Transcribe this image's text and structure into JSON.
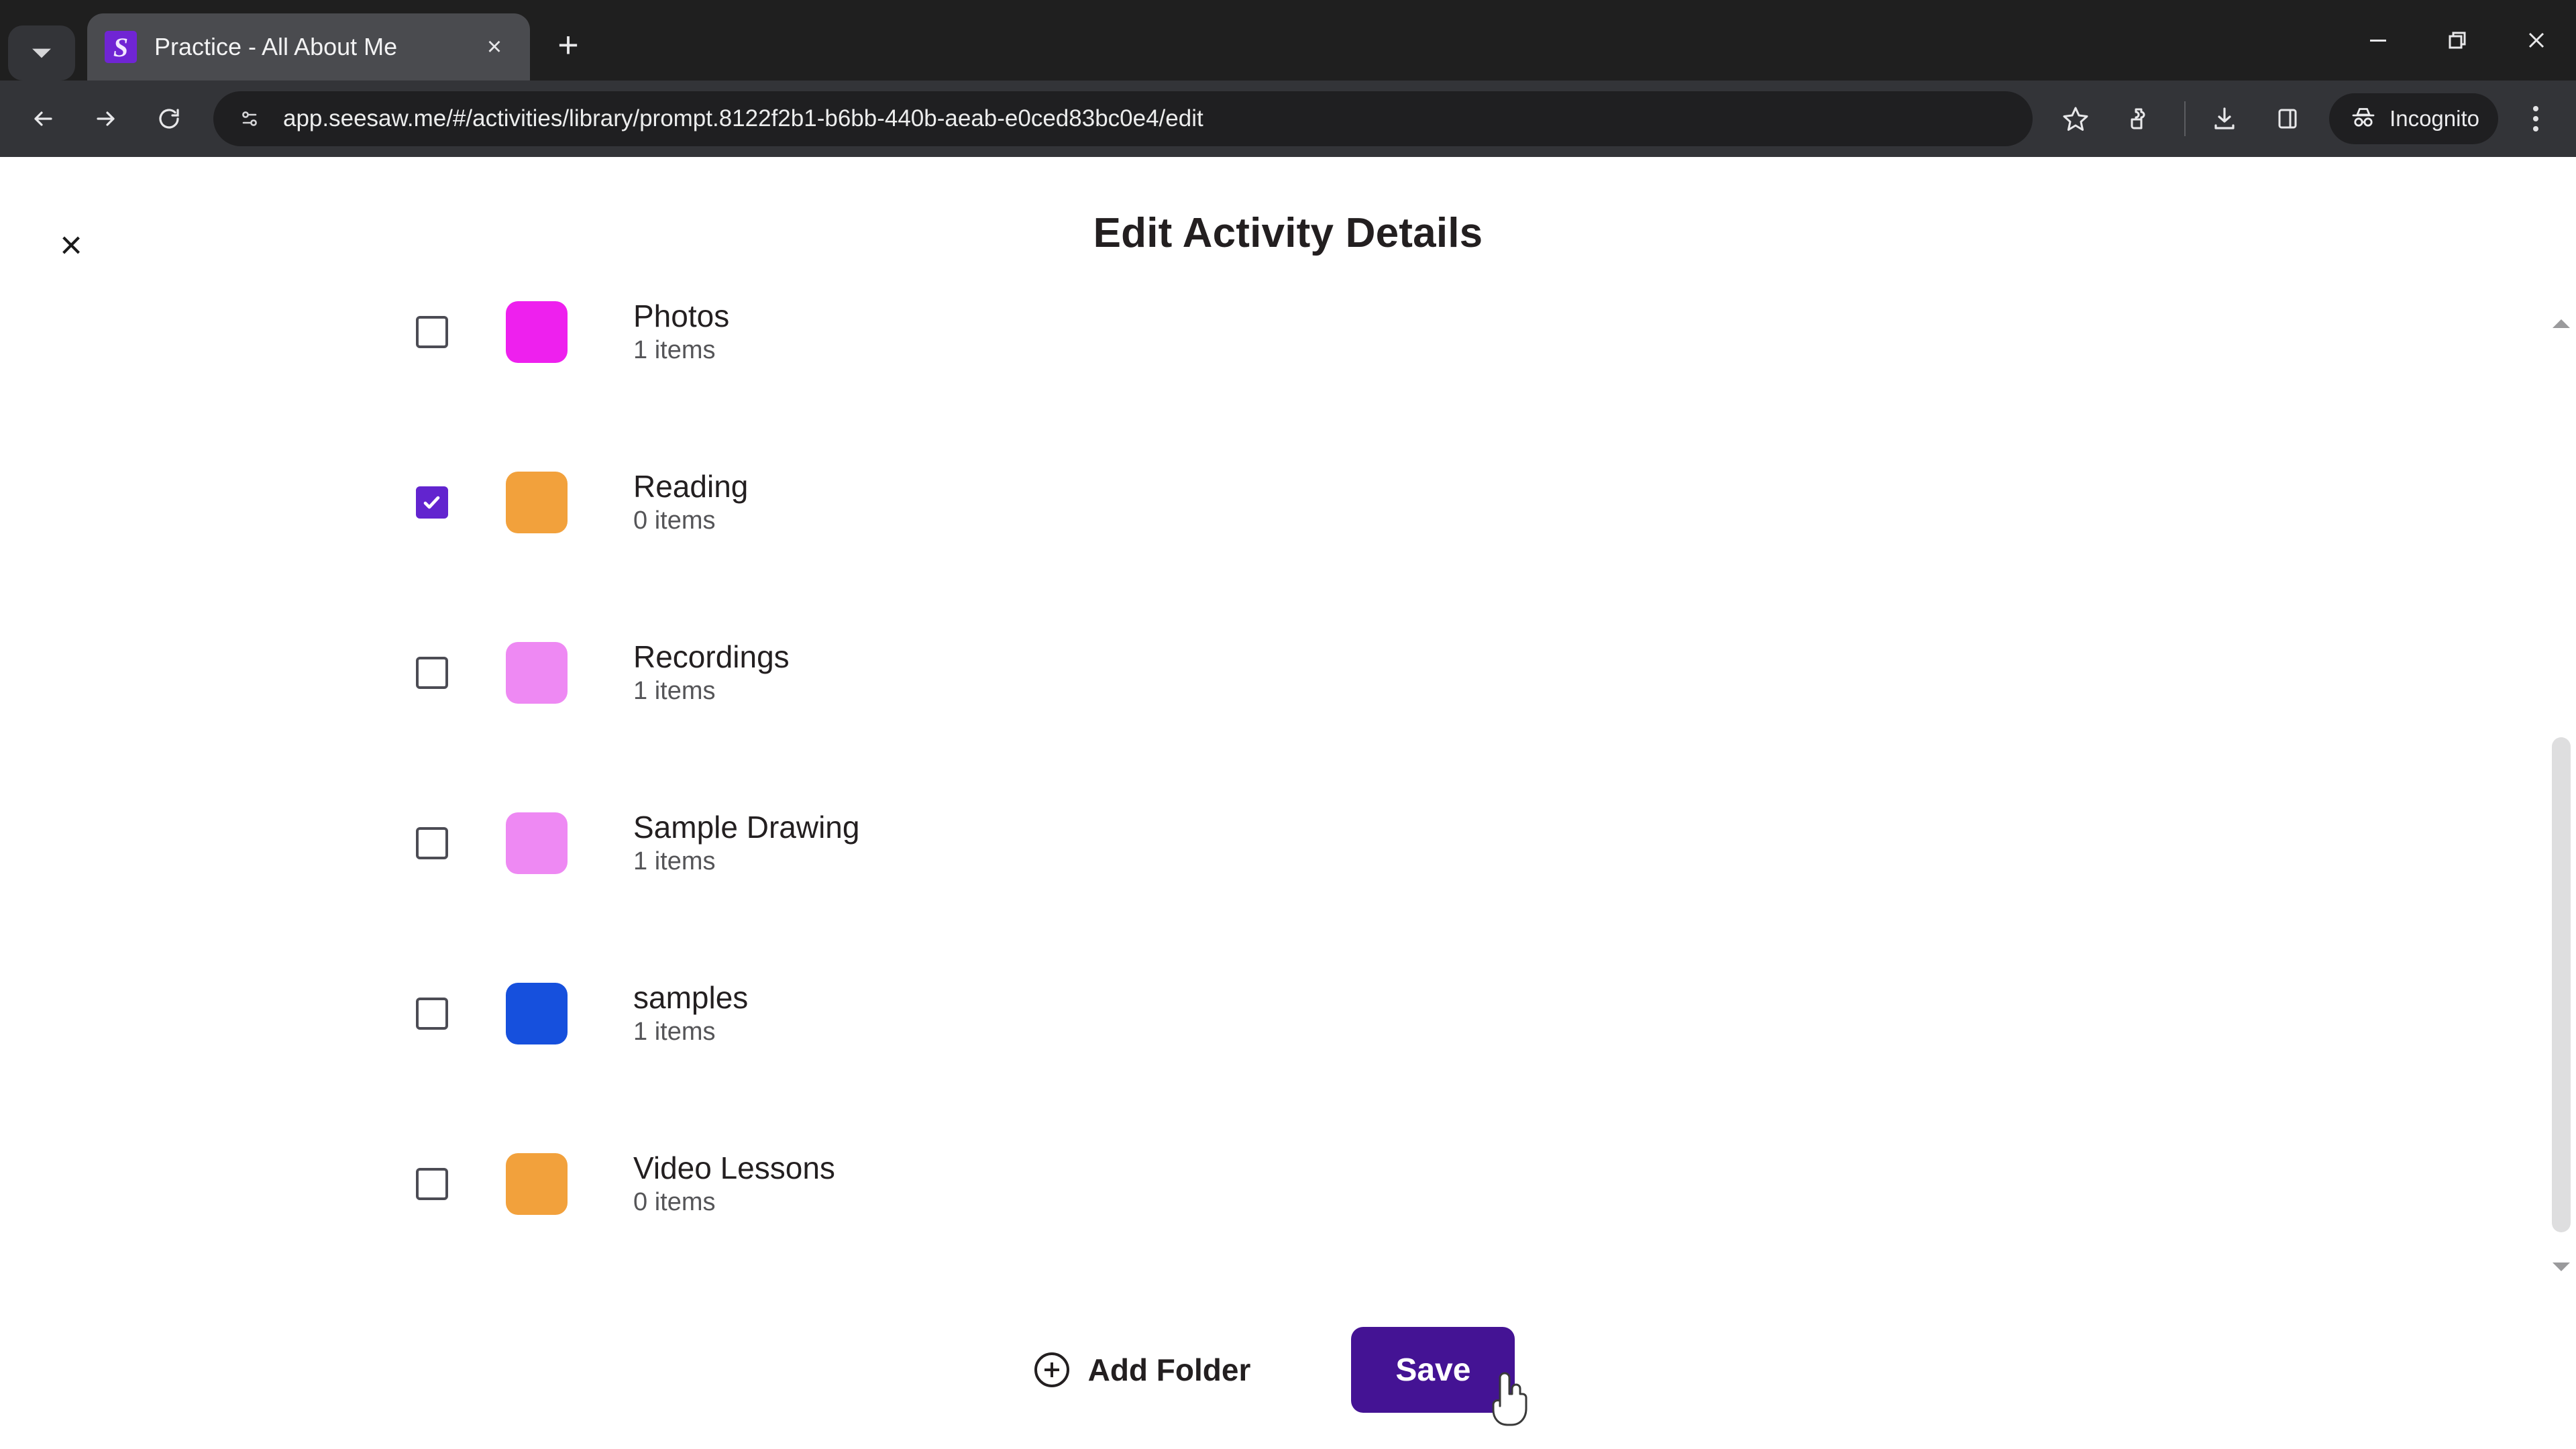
{
  "browser": {
    "tab_search_icon": "chevron-down-icon",
    "tab": {
      "favicon_letter": "S",
      "favicon_color": "#7025d4",
      "title": "Practice - All About Me",
      "close_glyph": "×"
    },
    "new_tab_glyph": "+",
    "window_controls": [
      "minimize",
      "restore",
      "close"
    ],
    "nav": {
      "back_icon": "back-arrow-icon",
      "forward_icon": "forward-arrow-icon",
      "reload_icon": "reload-icon",
      "site_info_icon": "site-settings-icon",
      "url": "app.seesaw.me/#/activities/library/prompt.8122f2b1-b6bb-440b-aeab-e0ced83bc0e4/edit",
      "bookmark_icon": "star-icon",
      "extensions_icon": "puzzle-piece-icon",
      "downloads_icon": "download-icon",
      "side_panel_icon": "side-panel-icon",
      "incognito_label": "Incognito",
      "incognito_icon": "incognito-hat-icon",
      "menu_icon": "kebab-menu-icon"
    }
  },
  "modal": {
    "close_glyph": "×",
    "title": "Edit Activity Details"
  },
  "folders": [
    {
      "name": "Photos",
      "count": "1 items",
      "color": "#ee20ee",
      "checked": false
    },
    {
      "name": "Reading",
      "count": "0 items",
      "color": "#f2a13c",
      "checked": true
    },
    {
      "name": "Recordings",
      "count": "1 items",
      "color": "#ee89f3",
      "checked": false
    },
    {
      "name": "Sample Drawing",
      "count": "1 items",
      "color": "#ee89f3",
      "checked": false
    },
    {
      "name": "samples",
      "count": "1 items",
      "color": "#1650dd",
      "checked": false
    },
    {
      "name": "Video Lessons",
      "count": "0 items",
      "color": "#f2a13c",
      "checked": false
    }
  ],
  "footer": {
    "add_folder_label": "Add Folder",
    "add_folder_icon": "plus-circle-icon",
    "save_label": "Save",
    "save_color": "#441394"
  },
  "colors": {
    "accent_purple": "#6224cf",
    "chrome_dark": "#1f1f1f",
    "toolbar": "#333438"
  }
}
